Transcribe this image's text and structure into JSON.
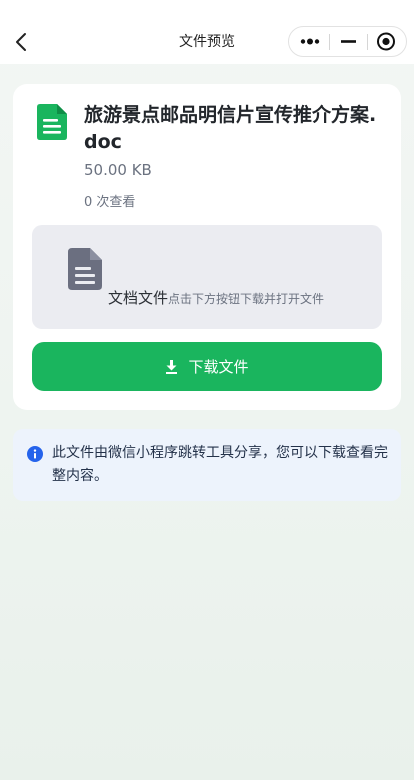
{
  "header": {
    "title": "文件预览",
    "back_icon": "chevron-left-icon",
    "more_icon": "more-dots-icon",
    "minimize_icon": "minus-icon",
    "close_icon": "target-circle-icon"
  },
  "file": {
    "name": "旅游景点邮品明信片宣传推介方案.doc",
    "size": "50.00 KB",
    "views": "0 次查看",
    "icon": "document-icon",
    "icon_color": "#1ab55e"
  },
  "preview": {
    "type_label": "文档文件",
    "hint": "点击下方按钮下载并打开文件",
    "icon": "document-icon",
    "icon_color": "#6b6f80"
  },
  "download": {
    "label": "下载文件",
    "icon": "download-icon",
    "color": "#1ab55e"
  },
  "notice": {
    "text": "此文件由微信小程序跳转工具分享，您可以下载查看完整内容。",
    "icon": "info-icon",
    "icon_color": "#2563eb",
    "background": "#edf3fc"
  }
}
